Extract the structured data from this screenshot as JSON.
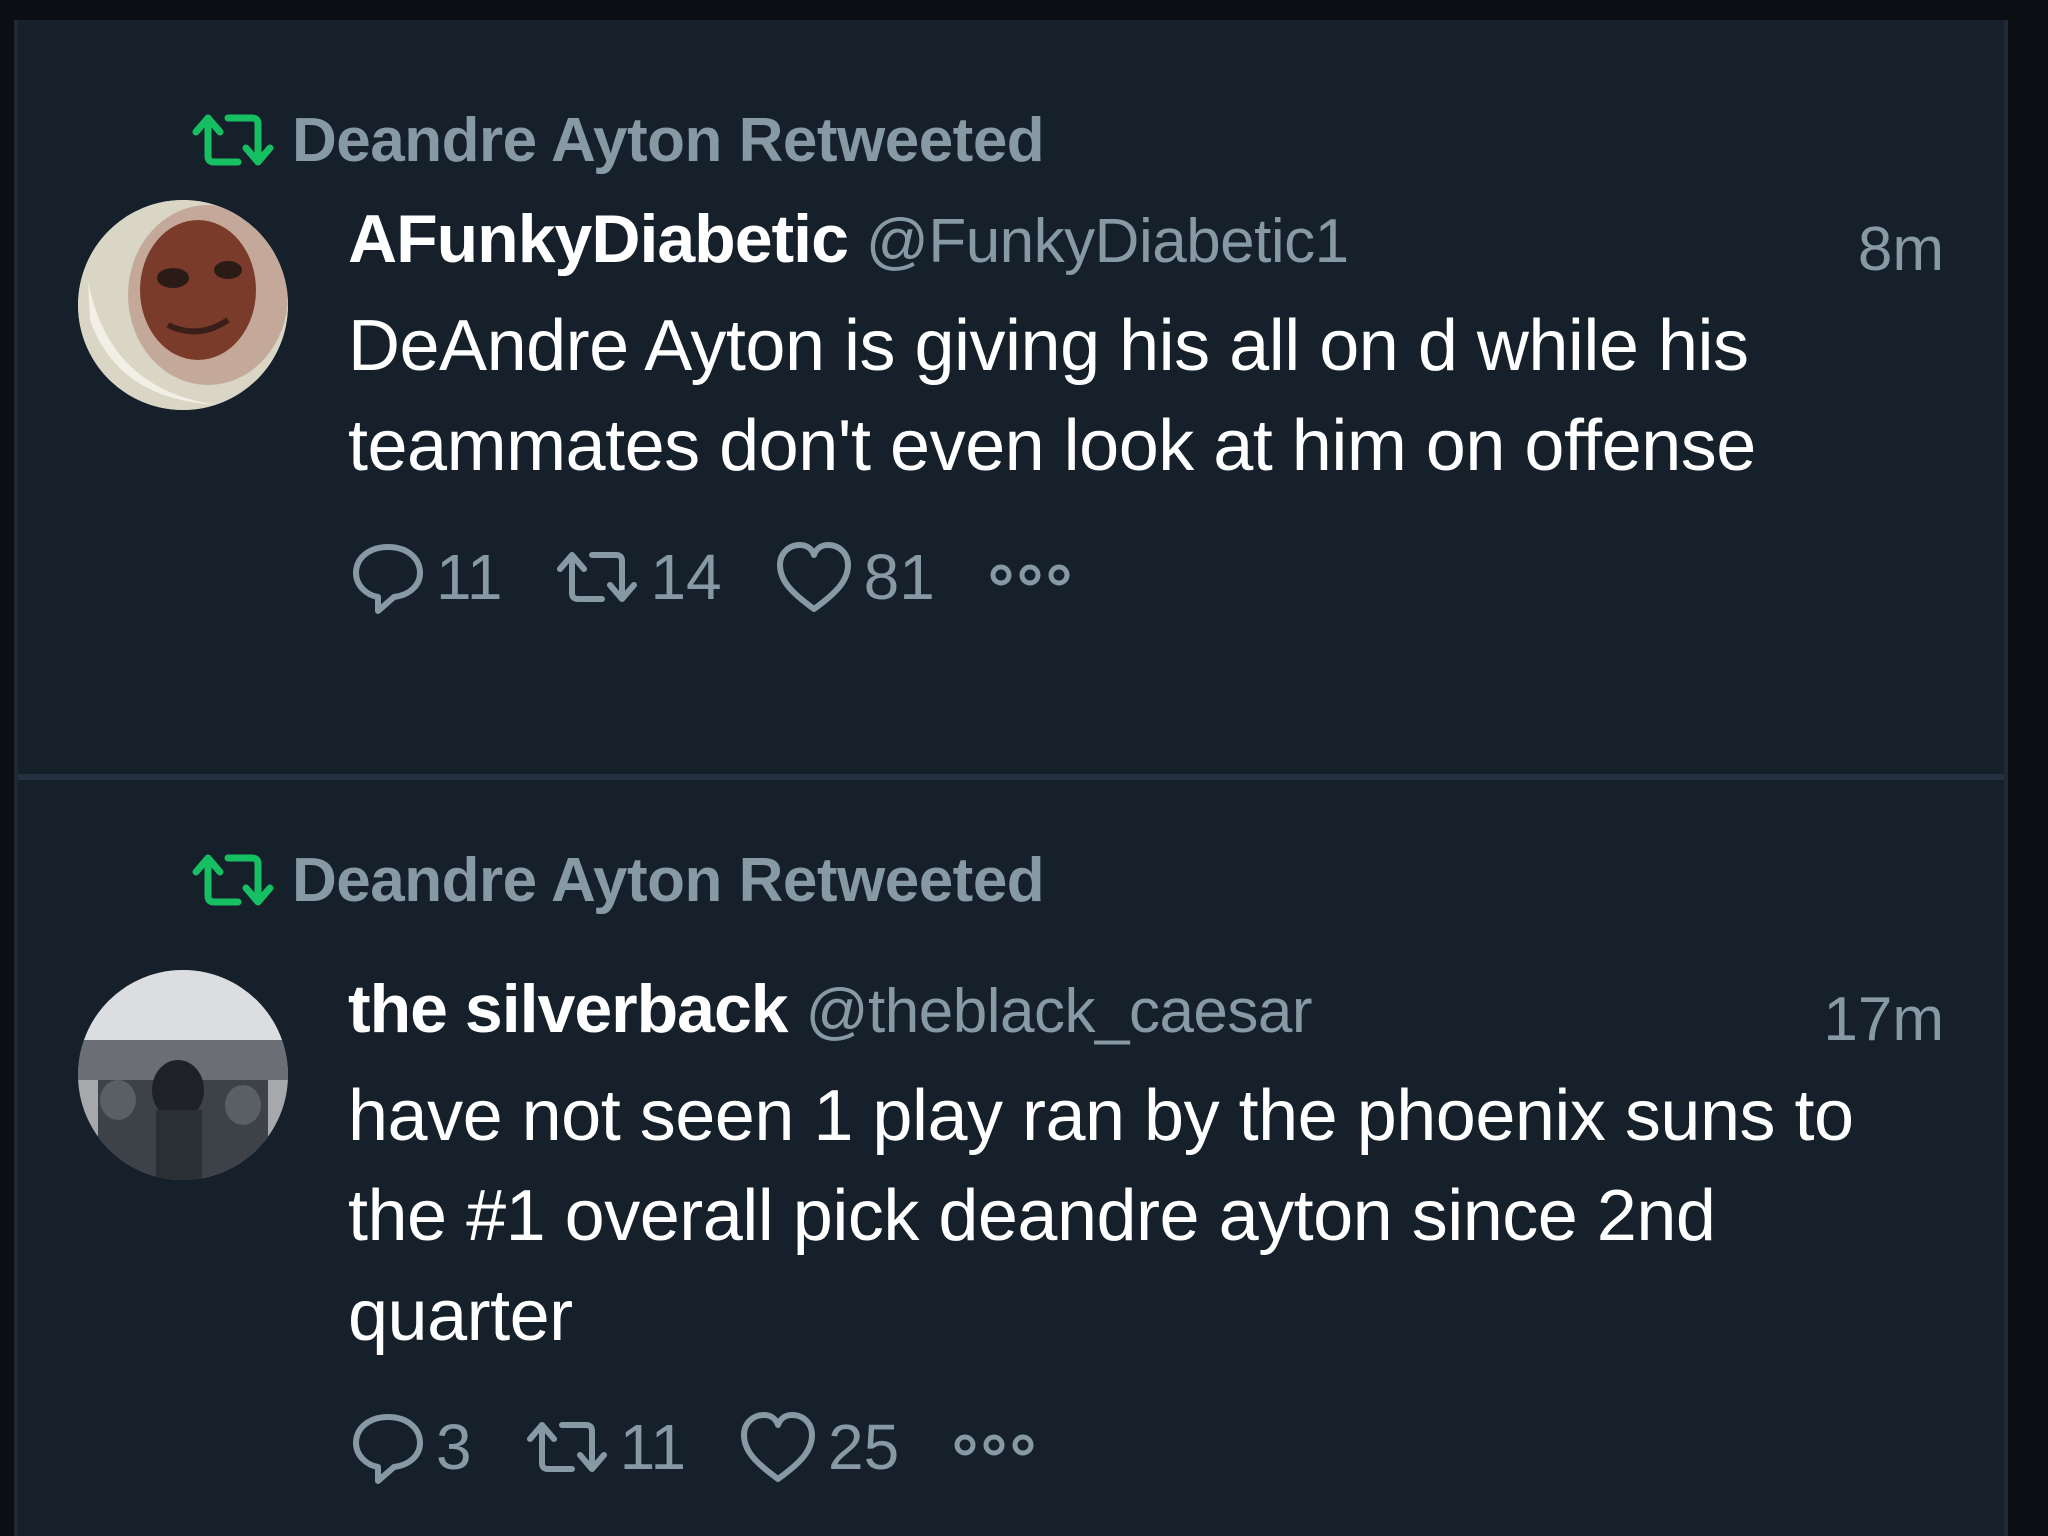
{
  "colors": {
    "background": "#15202b",
    "retweet_green": "#17bf63",
    "secondary_text": "#8899a6",
    "primary_text": "#ffffff"
  },
  "tweets": [
    {
      "retweet_label": "Deandre Ayton Retweeted",
      "name": "AFunkyDiabetic",
      "handle": "@FunkyDiabetic1",
      "time": "8m",
      "text": "DeAndre Ayton is giving his all on d while his teammates don't even look at him on offense",
      "replies": "11",
      "retweets": "14",
      "likes": "81",
      "avatar_icon": "avatar-photo"
    },
    {
      "retweet_label": "Deandre Ayton Retweeted",
      "name": "the silverback",
      "handle": "@theblack_caesar",
      "time": "17m",
      "text": "have not seen 1 play ran by the phoenix suns to the #1 overall pick deandre ayton since 2nd quarter",
      "replies": "3",
      "retweets": "11",
      "likes": "25",
      "avatar_icon": "avatar-photo"
    }
  ]
}
